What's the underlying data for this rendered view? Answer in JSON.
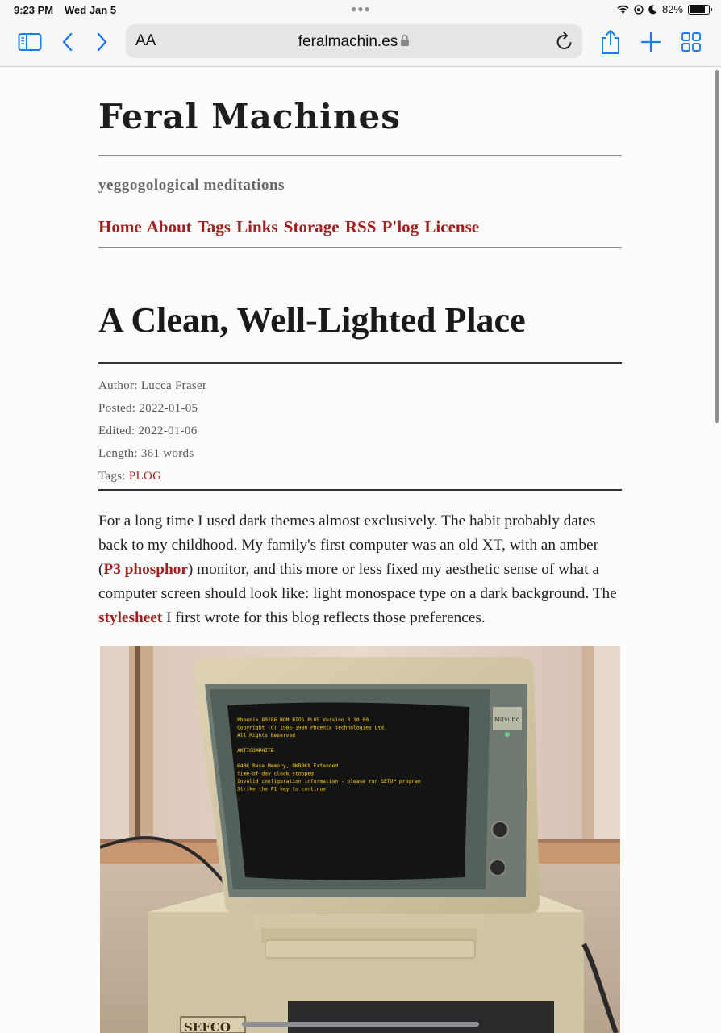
{
  "status_bar": {
    "time": "9:23 PM",
    "date": "Wed Jan 5",
    "battery": "82%",
    "battery_level": 0.82
  },
  "browser": {
    "text_size_label": "AA",
    "url": "feralmachin.es"
  },
  "site": {
    "title": "Feral Machines",
    "subtitle": "yeggogological meditations",
    "nav": [
      "Home",
      "About",
      "Tags",
      "Links",
      "Storage",
      "RSS",
      "P'log",
      "License"
    ]
  },
  "post": {
    "title": "A Clean, Well-Lighted Place",
    "meta": {
      "author_label": "Author:",
      "author": "Lucca Fraser",
      "posted_label": "Posted:",
      "posted": "2022-01-05",
      "edited_label": "Edited:",
      "edited": "2022-01-06",
      "length_label": "Length:",
      "length": "361 words",
      "tags_label": "Tags:",
      "tag": "PLOG"
    },
    "paragraph": {
      "part1": "For a long time I used dark themes almost exclusively. The habit probably dates back to my childhood. My family's first computer was an old XT, with an amber (",
      "link1": "P3 phosphor",
      "part2": ") monitor, and this more or less fixed my aesthetic sense of what a computer screen should look like: light monospace type on a dark background. The ",
      "link2": "stylesheet",
      "part3": " I first wrote for this blog reflects those preferences."
    },
    "photo": {
      "monitor_brand": "Mitsubo",
      "case_label": "SEFCO",
      "screen_lines": [
        "Phoenix 80286 ROM BIOS PLUS Version 3.10 00",
        "Copyright (C) 1985-1988 Phoenix Technologies Ltd.",
        "All Rights Reserved",
        "",
        "ANTIGOMPHITE",
        "",
        "640K Base Memory, 0KB8K8 Extended",
        "Time-of-day clock stopped",
        "Invalid configuration information - please run SETUP program",
        "  Strike the F1 key to continue",
        "_"
      ]
    }
  }
}
